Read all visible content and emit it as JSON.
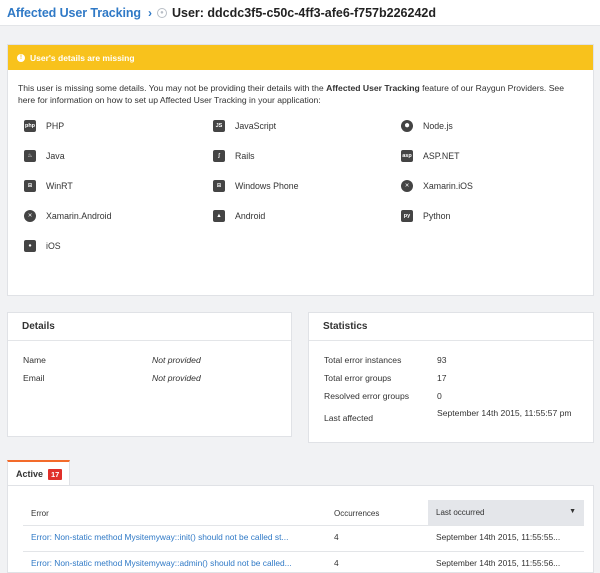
{
  "header": {
    "breadcrumb": "Affected User Tracking",
    "title": "User: ddcdc3f5-c50c-4ff3-afe6-f757b226242d"
  },
  "warning": {
    "title": "User's details are missing",
    "message_pre": "This user is missing some details. You may not be providing their details with the ",
    "message_bold": "Affected User Tracking",
    "message_post": " feature of our Raygun Providers. See here for information on how to set up Affected User Tracking in your application:",
    "providers": [
      {
        "label": "PHP",
        "icon": "php-icon",
        "glyph": "php"
      },
      {
        "label": "JavaScript",
        "icon": "javascript-icon",
        "glyph": "JS"
      },
      {
        "label": "Node.js",
        "icon": "nodejs-icon",
        "glyph": "⬢"
      },
      {
        "label": "Java",
        "icon": "java-icon",
        "glyph": "♨"
      },
      {
        "label": "Rails",
        "icon": "rails-icon",
        "glyph": "ʃ"
      },
      {
        "label": "ASP.NET",
        "icon": "aspnet-icon",
        "glyph": "asp"
      },
      {
        "label": "WinRT",
        "icon": "windows-icon",
        "glyph": "⊞"
      },
      {
        "label": "Windows Phone",
        "icon": "windows-phone-icon",
        "glyph": "⊞"
      },
      {
        "label": "Xamarin.iOS",
        "icon": "xamarin-icon",
        "glyph": "✕"
      },
      {
        "label": "Xamarin.Android",
        "icon": "xamarin-icon",
        "glyph": "✕"
      },
      {
        "label": "Android",
        "icon": "android-icon",
        "glyph": "▲"
      },
      {
        "label": "Python",
        "icon": "python-icon",
        "glyph": "py"
      },
      {
        "label": "iOS",
        "icon": "apple-icon",
        "glyph": "●"
      }
    ]
  },
  "details": {
    "title": "Details",
    "rows": [
      {
        "key": "Name",
        "value": "Not provided"
      },
      {
        "key": "Email",
        "value": "Not provided"
      }
    ]
  },
  "statistics": {
    "title": "Statistics",
    "rows": [
      {
        "key": "Total error instances",
        "value": "93"
      },
      {
        "key": "Total error groups",
        "value": "17"
      },
      {
        "key": "Resolved error groups",
        "value": "0"
      },
      {
        "key": "Last affected",
        "value": "September 14th 2015, 11:55:57 pm"
      }
    ]
  },
  "tabs": [
    {
      "label": "Active",
      "count": "17"
    }
  ],
  "table": {
    "columns": {
      "error": "Error",
      "occurrences": "Occurrences",
      "last": "Last occurred"
    },
    "rows": [
      {
        "error": "Error: Non-static method Mysitemyway::init() should not be called st...",
        "occurrences": "4",
        "last": "September 14th 2015, 11:55:55..."
      },
      {
        "error": "Error: Non-static method Mysitemyway::admin() should not be called...",
        "occurrences": "4",
        "last": "September 14th 2015, 11:55:56..."
      }
    ]
  },
  "colors": {
    "accent": "#2f79c6",
    "warning": "#f8c21c",
    "badge": "#e0302a",
    "tab_active": "#f36b2a"
  }
}
